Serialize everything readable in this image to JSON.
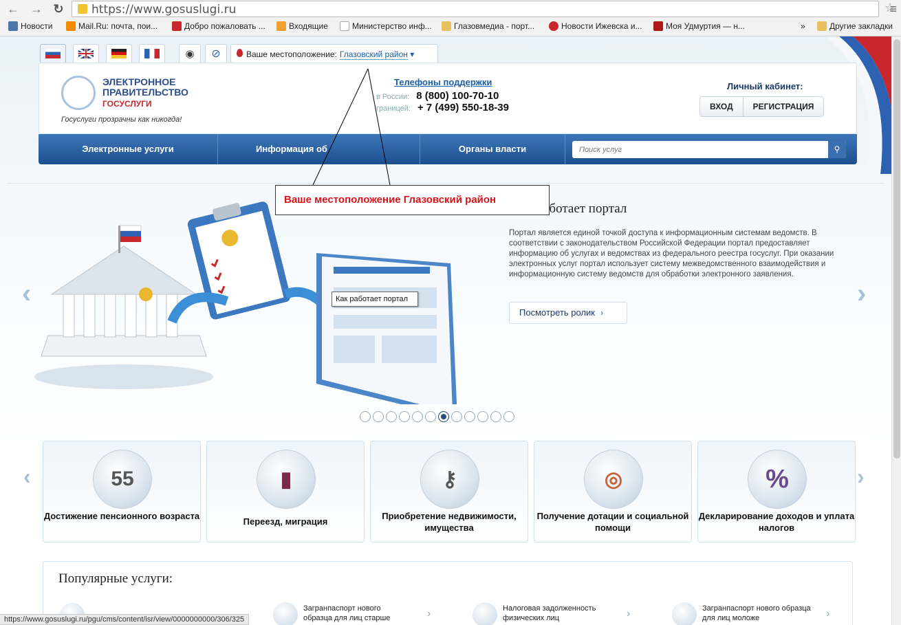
{
  "browser": {
    "url": "https://www.gosuslugi.ru",
    "back_icon": "back-arrow-icon",
    "forward_icon": "forward-arrow-icon",
    "reload_icon": "reload-icon",
    "bookmarks": [
      {
        "label": "Новости",
        "color": "#4a76a8"
      },
      {
        "label": "Mail.Ru: почта, пои...",
        "color": "#f28b00"
      },
      {
        "label": "Добро пожаловать ...",
        "color": "#c8282d"
      },
      {
        "label": "Входящие",
        "color": "#f0a030"
      },
      {
        "label": "Министерство инф...",
        "color": "#dddddd"
      },
      {
        "label": "Глазовмедиа - порт...",
        "color": "#e8c060"
      },
      {
        "label": "Новости Ижевска и...",
        "color": "#c8282d"
      },
      {
        "label": "Моя Удмуртия — н...",
        "color": "#b01818"
      }
    ],
    "more_bookmarks": "»",
    "other_bookmarks": "Другие закладки"
  },
  "topbar": {
    "languages": [
      "ru",
      "en",
      "de",
      "fr"
    ],
    "location_label": "Ваше местоположение:",
    "location_value": "Глазовский район"
  },
  "header": {
    "logo_line1": "ЭЛЕКТРОННОЕ ПРАВИТЕЛЬСТВО",
    "logo_line2": "ГОСУСЛУГИ",
    "slogan": "Госуслуги прозрачны как никогда!",
    "phones_title": "Телефоны поддержки",
    "phone_russia_label": "в России:",
    "phone_russia": "8 (800) 100-70-10",
    "phone_abroad_label": "границей:",
    "phone_abroad": "+ 7 (499) 550-18-39",
    "cabinet_title": "Личный кабинет:",
    "login": "ВХОД",
    "register": "РЕГИСТРАЦИЯ"
  },
  "nav": {
    "items": [
      "Электронные услуги",
      "Информация об",
      "Органы власти"
    ],
    "search_placeholder": "Поиск услуг"
  },
  "callout": "Ваше местоположение Глазовский район",
  "slide": {
    "title": "аботает портал",
    "text": "Портал является единой точкой доступа к информационным системам ведомств. В соответствии с законодательством Российской Федерации портал предоставляет информацию об услугах и ведомствах из федерального реестра госуслуг. При оказании электронных услуг портал использует систему межведомственного взаимодействия и информационную систему ведомств для обработки электронного заявления.",
    "button": "Посмотреть ролик",
    "tooltip": "Как работает портал",
    "dots_total": 12,
    "dots_active": 7
  },
  "categories": [
    {
      "label": "Достижение пенсионного возраста",
      "icon": "calendar-icon",
      "glyph": "55"
    },
    {
      "label": "Переезд, миграция",
      "icon": "passport-icon",
      "glyph": "▮"
    },
    {
      "label": "Приобретение недвижимости, имущества",
      "icon": "keys-icon",
      "glyph": "⚷"
    },
    {
      "label": "Получение дотации и социальной помощи",
      "icon": "lifebuoy-icon",
      "glyph": "◎"
    },
    {
      "label": "Декларирование доходов и уплата налогов",
      "icon": "percent-icon",
      "glyph": "%"
    }
  ],
  "popular": {
    "title": "Популярные услуги:",
    "items": [
      {
        "label": "Загранпаспорт нового образца для лиц старше"
      },
      {
        "label": "Налоговая задолженность физических лиц"
      },
      {
        "label": "Загранпаспорт нового образца для лиц моложе"
      }
    ]
  },
  "status_url": "https://www.gosuslugi.ru/pgu/cms/content/isr/view/0000000000/306/325"
}
